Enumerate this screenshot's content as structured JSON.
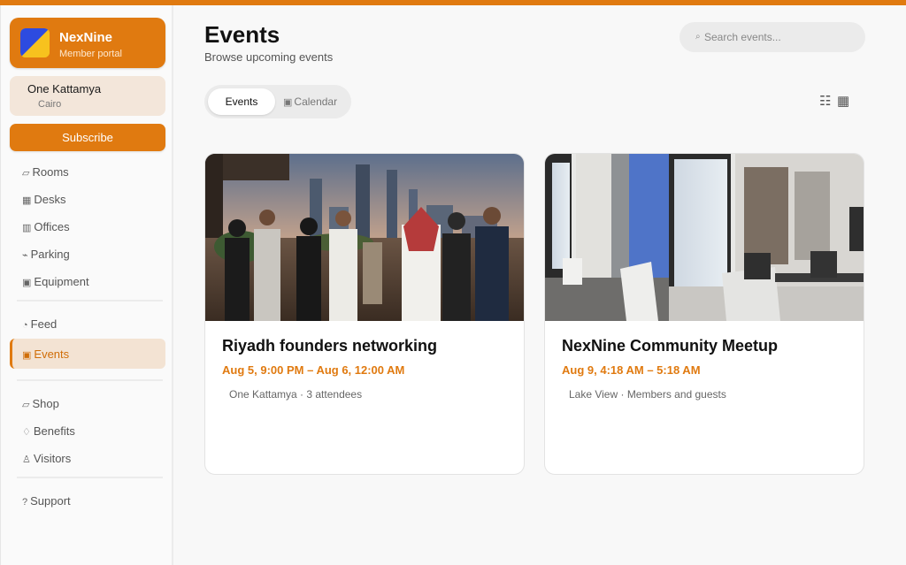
{
  "brand": {
    "name": "NexNine",
    "subtitle": "Member portal",
    "accent": "#e07a10"
  },
  "location": {
    "name": "One Kattamya",
    "city": "Cairo"
  },
  "subscribe_label": "Subscribe",
  "nav": {
    "group1": [
      {
        "icon": "▱",
        "label": "Rooms"
      },
      {
        "icon": "▦",
        "label": "Desks"
      },
      {
        "icon": "▥",
        "label": "Offices"
      },
      {
        "icon": "⌁",
        "label": "Parking"
      },
      {
        "icon": "▣",
        "label": "Equipment"
      }
    ],
    "group2": [
      {
        "icon": "◔",
        "label": "Feed"
      },
      {
        "icon": "▣",
        "label": "Events"
      }
    ],
    "group3": [
      {
        "icon": "▱",
        "label": "Shop"
      },
      {
        "icon": "♢",
        "label": "Benefits"
      },
      {
        "icon": "♙",
        "label": "Visitors"
      }
    ],
    "group4": [
      {
        "icon": "?",
        "label": "Support"
      }
    ]
  },
  "header": {
    "title": "Events",
    "subtitle": "Browse upcoming events"
  },
  "search": {
    "icon": "⌕",
    "placeholder": "Search events..."
  },
  "view_toggle": {
    "active": "Events",
    "inactive_icon": "▣",
    "inactive": "Calendar"
  },
  "layout_icons": {
    "list": "☷",
    "grid": "▦"
  },
  "events": [
    {
      "title": "Riyadh founders networking",
      "date": "Aug 5, 9:00 PM – Aug 6, 12:00 AM",
      "meta": "One Kattamya · 3 attendees"
    },
    {
      "title": "NexNine Community Meetup",
      "date": "Aug 9, 4:18 AM – 5:18 AM",
      "meta": "Lake View · Members and guests"
    }
  ]
}
